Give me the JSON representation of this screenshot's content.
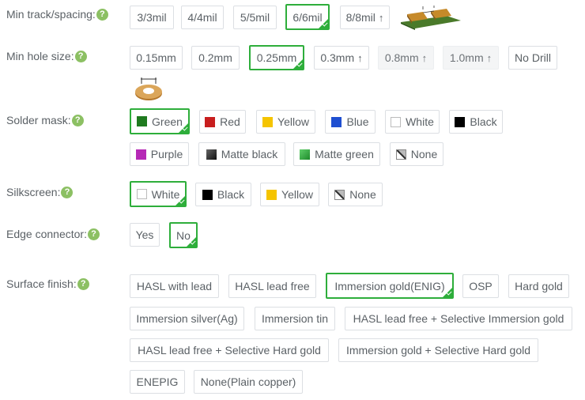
{
  "track_spacing": {
    "label": "Min track/spacing:",
    "help": "?",
    "options": [
      {
        "text": "3/3mil"
      },
      {
        "text": "4/4mil"
      },
      {
        "text": "5/5mil"
      },
      {
        "text": "6/6mil",
        "selected": true
      },
      {
        "text": "8/8mil",
        "arrow": "↑"
      }
    ]
  },
  "hole_size": {
    "label": "Min hole size:",
    "help": "?",
    "options": [
      {
        "text": "0.15mm"
      },
      {
        "text": "0.2mm"
      },
      {
        "text": "0.25mm",
        "selected": true
      },
      {
        "text": "0.3mm",
        "arrow": "↑"
      },
      {
        "text": "0.8mm",
        "arrow": "↑",
        "disabled": true
      },
      {
        "text": "1.0mm",
        "arrow": "↑",
        "disabled": true
      },
      {
        "text": "No Drill"
      }
    ]
  },
  "solder_mask": {
    "label": "Solder mask:",
    "help": "?",
    "options": [
      {
        "text": "Green",
        "color": "#1f7a1f",
        "selected": true
      },
      {
        "text": "Red",
        "color": "#c81e1e"
      },
      {
        "text": "Yellow",
        "color": "#f5c400"
      },
      {
        "text": "Blue",
        "color": "#1f4fd1"
      },
      {
        "text": "White",
        "color": "#ffffff"
      },
      {
        "text": "Black",
        "color": "#000000"
      },
      {
        "text": "Purple",
        "color": "#b629b6"
      },
      {
        "text": "Matte black",
        "color": "#333333"
      },
      {
        "text": "Matte green",
        "color": "#2ea33a"
      },
      {
        "text": "None",
        "color": "none"
      }
    ]
  },
  "silkscreen": {
    "label": "Silkscreen:",
    "help": "?",
    "options": [
      {
        "text": "White",
        "color": "#ffffff",
        "selected": true
      },
      {
        "text": "Black",
        "color": "#000000"
      },
      {
        "text": "Yellow",
        "color": "#f5c400"
      },
      {
        "text": "None",
        "color": "none"
      }
    ]
  },
  "edge_connector": {
    "label": "Edge connector:",
    "help": "?",
    "options": [
      {
        "text": "Yes"
      },
      {
        "text": "No",
        "selected": true
      }
    ]
  },
  "surface_finish": {
    "label": "Surface finish:",
    "help": "?",
    "options": [
      {
        "text": "HASL with lead"
      },
      {
        "text": "HASL lead free"
      },
      {
        "text": "Immersion gold(ENIG)",
        "selected": true
      },
      {
        "text": "OSP"
      },
      {
        "text": "Hard gold"
      },
      {
        "text": "Immersion silver(Ag)"
      },
      {
        "text": "Immersion tin"
      },
      {
        "text": "HASL lead free + Selective Immersion gold"
      },
      {
        "text": "HASL lead free + Selective Hard gold"
      },
      {
        "text": "Immersion gold + Selective Hard gold"
      },
      {
        "text": "ENEPIG"
      },
      {
        "text": "None(Plain copper)"
      }
    ]
  },
  "colors": {
    "selected_border": "#2eae3b",
    "help_icon": "#8cc063",
    "border": "#dcdfe3"
  }
}
